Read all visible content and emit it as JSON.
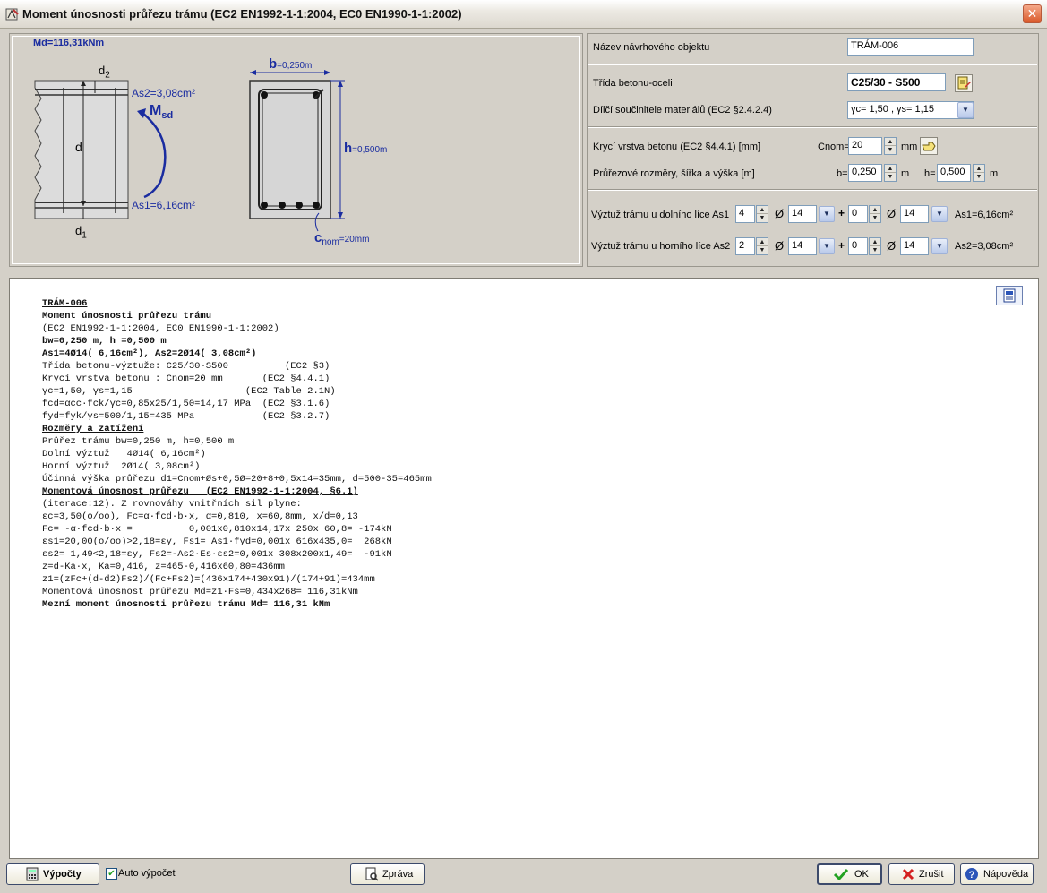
{
  "window": {
    "title": "Moment únosnosti průřezu trámu (EC2 EN1992-1-1:2004, EC0 EN1990-1-1:2002)",
    "close": "✕"
  },
  "diagram": {
    "md": "Md=116,31kNm",
    "d2": "d",
    "d2_sub": "2",
    "as2": "As2=3,08cm²",
    "msd": "M",
    "msd_sub": "sd",
    "d": "d",
    "as1": "As1=6,16cm²",
    "d1": "d",
    "d1_sub": "1",
    "b_label": "b",
    "b_value": "=0,250m",
    "h_label": "h",
    "h_value": "=0,500m",
    "cnom": "c",
    "cnom_sub": "nom",
    "cnom_value": "=20mm"
  },
  "form": {
    "name_label": "Název návrhového objektu",
    "name_value": "TRÁM-006",
    "class_label": "Třída betonu-oceli",
    "class_value": "C25/30 - S500",
    "factors_label": "Dílčí součinitele materiálů (EC2 §2.4.2.4)",
    "factors_value": "γc= 1,50 , γs= 1,15",
    "cover_label": "Krycí vrstva betonu (EC2 §4.4.1) [mm]",
    "cnom_label": "Cnom=",
    "cnom_value": "20",
    "cnom_unit": "mm",
    "dims_label": "Průřezové rozměry, šířka a výška [m]",
    "b_label": "b=",
    "b_value": "0,250",
    "b_unit": "m",
    "h_label": "h=",
    "h_value": "0,500",
    "h_unit": "m",
    "bottom_label": "Výztuž trámu u dolního líce As1",
    "bottom": {
      "n1": "4",
      "d1": "14",
      "n2": "0",
      "d2": "14",
      "result": "As1=6,16cm²"
    },
    "top_label": "Výztuž trámu u horního líce As2",
    "top": {
      "n1": "2",
      "d1": "14",
      "n2": "0",
      "d2": "14",
      "result": "As2=3,08cm²"
    },
    "diam_symbol": "Ø",
    "plus": "+"
  },
  "report": {
    "lines": [
      {
        "text": "TRÁM-006",
        "style": "b ul"
      },
      {
        "text": "Moment únosnosti průřezu trámu",
        "style": "b"
      },
      {
        "text": "(EC2 EN1992-1-1:2004, EC0 EN1990-1-1:2002)",
        "style": ""
      },
      {
        "text": "bw=0,250 m, h =0,500 m",
        "style": "b"
      },
      {
        "text": "As1=4Ø14( 6,16cm²), As2=2Ø14( 3,08cm²)",
        "style": "b"
      },
      {
        "text": "Třída betonu-výztuže: C25/30-S500          (EC2 §3)",
        "style": ""
      },
      {
        "text": "Krycí vrstva betonu : Cnom=20 mm       (EC2 §4.4.1)",
        "style": ""
      },
      {
        "text": "γc=1,50, γs=1,15                    (EC2 Table 2.1N)",
        "style": ""
      },
      {
        "text": "fcd=αcc·fck/γc=0,85x25/1,50=14,17 MPa  (EC2 §3.1.6)",
        "style": ""
      },
      {
        "text": "fyd=fyk/γs=500/1,15=435 MPa            (EC2 §3.2.7)",
        "style": ""
      },
      {
        "text": "Rozměry a zatížení",
        "style": "b ul"
      },
      {
        "text": "Průřez trámu bw=0,250 m, h=0,500 m",
        "style": ""
      },
      {
        "text": "Dolní výztuž   4Ø14( 6,16cm²)",
        "style": ""
      },
      {
        "text": "Horní výztuž  2Ø14( 3,08cm²)",
        "style": ""
      },
      {
        "text": "Účinná výška průřezu d1=Cnom+Øs+0,5Ø=20+8+0,5x14=35mm, d=500-35=465mm",
        "style": ""
      },
      {
        "text": "Momentová únosnost průřezu   (EC2 EN1992-1-1:2004, §6.1)",
        "style": "b ul"
      },
      {
        "text": "(iterace:12). Z rovnováhy vnitřních sil plyne:",
        "style": ""
      },
      {
        "text": "εc=3,50(o/oo), Fc=α·fcd·b·x, α=0,810, x=60,8mm, x/d=0,13",
        "style": ""
      },
      {
        "text": "Fc= -α·fcd·b·x =          0,001x0,810x14,17x 250x 60,8= -174kN",
        "style": ""
      },
      {
        "text": "εs1=20,00(o/oo)>2,18=εy, Fs1= As1·fyd=0,001x 616x435,0=  268kN",
        "style": ""
      },
      {
        "text": "εs2= 1,49<2,18=εy, Fs2=-As2·Es·εs2=0,001x 308x200x1,49=  -91kN",
        "style": ""
      },
      {
        "text": "z=d-Ka·x, Ka=0,416, z=465-0,416x60,80=436mm",
        "style": ""
      },
      {
        "text": "z1=(zFc+(d-d2)Fs2)/(Fc+Fs2)=(436x174+430x91)/(174+91)=434mm",
        "style": ""
      },
      {
        "text": "Momentová únosnost průřezu Md=z1·Fs=0,434x268= 116,31kNm",
        "style": ""
      },
      {
        "text": "Mezní moment únosnosti průřezu trámu Md= 116,31 kNm",
        "style": "b"
      }
    ]
  },
  "footer": {
    "calc_label": "Výpočty",
    "auto_label": "Auto výpočet",
    "auto_checked": true,
    "report_label": "Zpráva",
    "ok_label": "OK",
    "cancel_label": "Zrušit",
    "help_label": "Nápověda"
  }
}
